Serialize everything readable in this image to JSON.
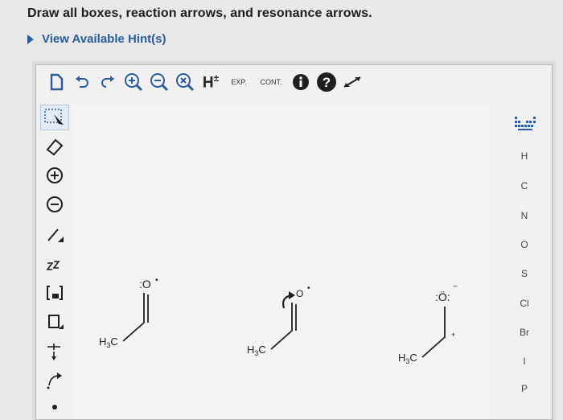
{
  "instruction": "Draw all boxes, reaction arrows, and resonance arrows.",
  "hint": {
    "label": "View Available Hint(s)"
  },
  "toolbar": {
    "items": [
      "new-doc-icon",
      "undo-icon",
      "redo-icon",
      "zoom-in-icon",
      "zoom-out-icon",
      "zoom-reset-icon",
      "hydrogens-button",
      "expand-button",
      "contract-button",
      "info-icon",
      "help-icon",
      "fullscreen-icon"
    ],
    "hydrogens_label": "H",
    "hydrogens_sup": "±",
    "expand_label": "EXP.",
    "contract_label": "CONT."
  },
  "left_tools": [
    "select-tool",
    "eraser-tool",
    "positive-charge-tool",
    "negative-charge-tool",
    "single-bond-tool",
    "chain-tool",
    "bracket-tool",
    "box-tool",
    "reaction-arrow-tool",
    "curved-arrow-tool",
    "dot-tool"
  ],
  "elements": [
    "H",
    "C",
    "N",
    "O",
    "S",
    "Cl",
    "Br",
    "I",
    "P"
  ],
  "structures": [
    {
      "label": "H3C",
      "sub": "3",
      "O_label": ":O",
      "radical": "•"
    },
    {
      "label": "H3C",
      "sub": "3",
      "O_label": "O",
      "radical": "•"
    },
    {
      "label": "H3C",
      "sub": "3",
      "O_label": ":Ö:",
      "charge": "−",
      "plus": "+"
    }
  ],
  "colors": {
    "accent": "#2a5d9f",
    "background": "#e9e9ea",
    "canvas": "#f4f4f5"
  }
}
